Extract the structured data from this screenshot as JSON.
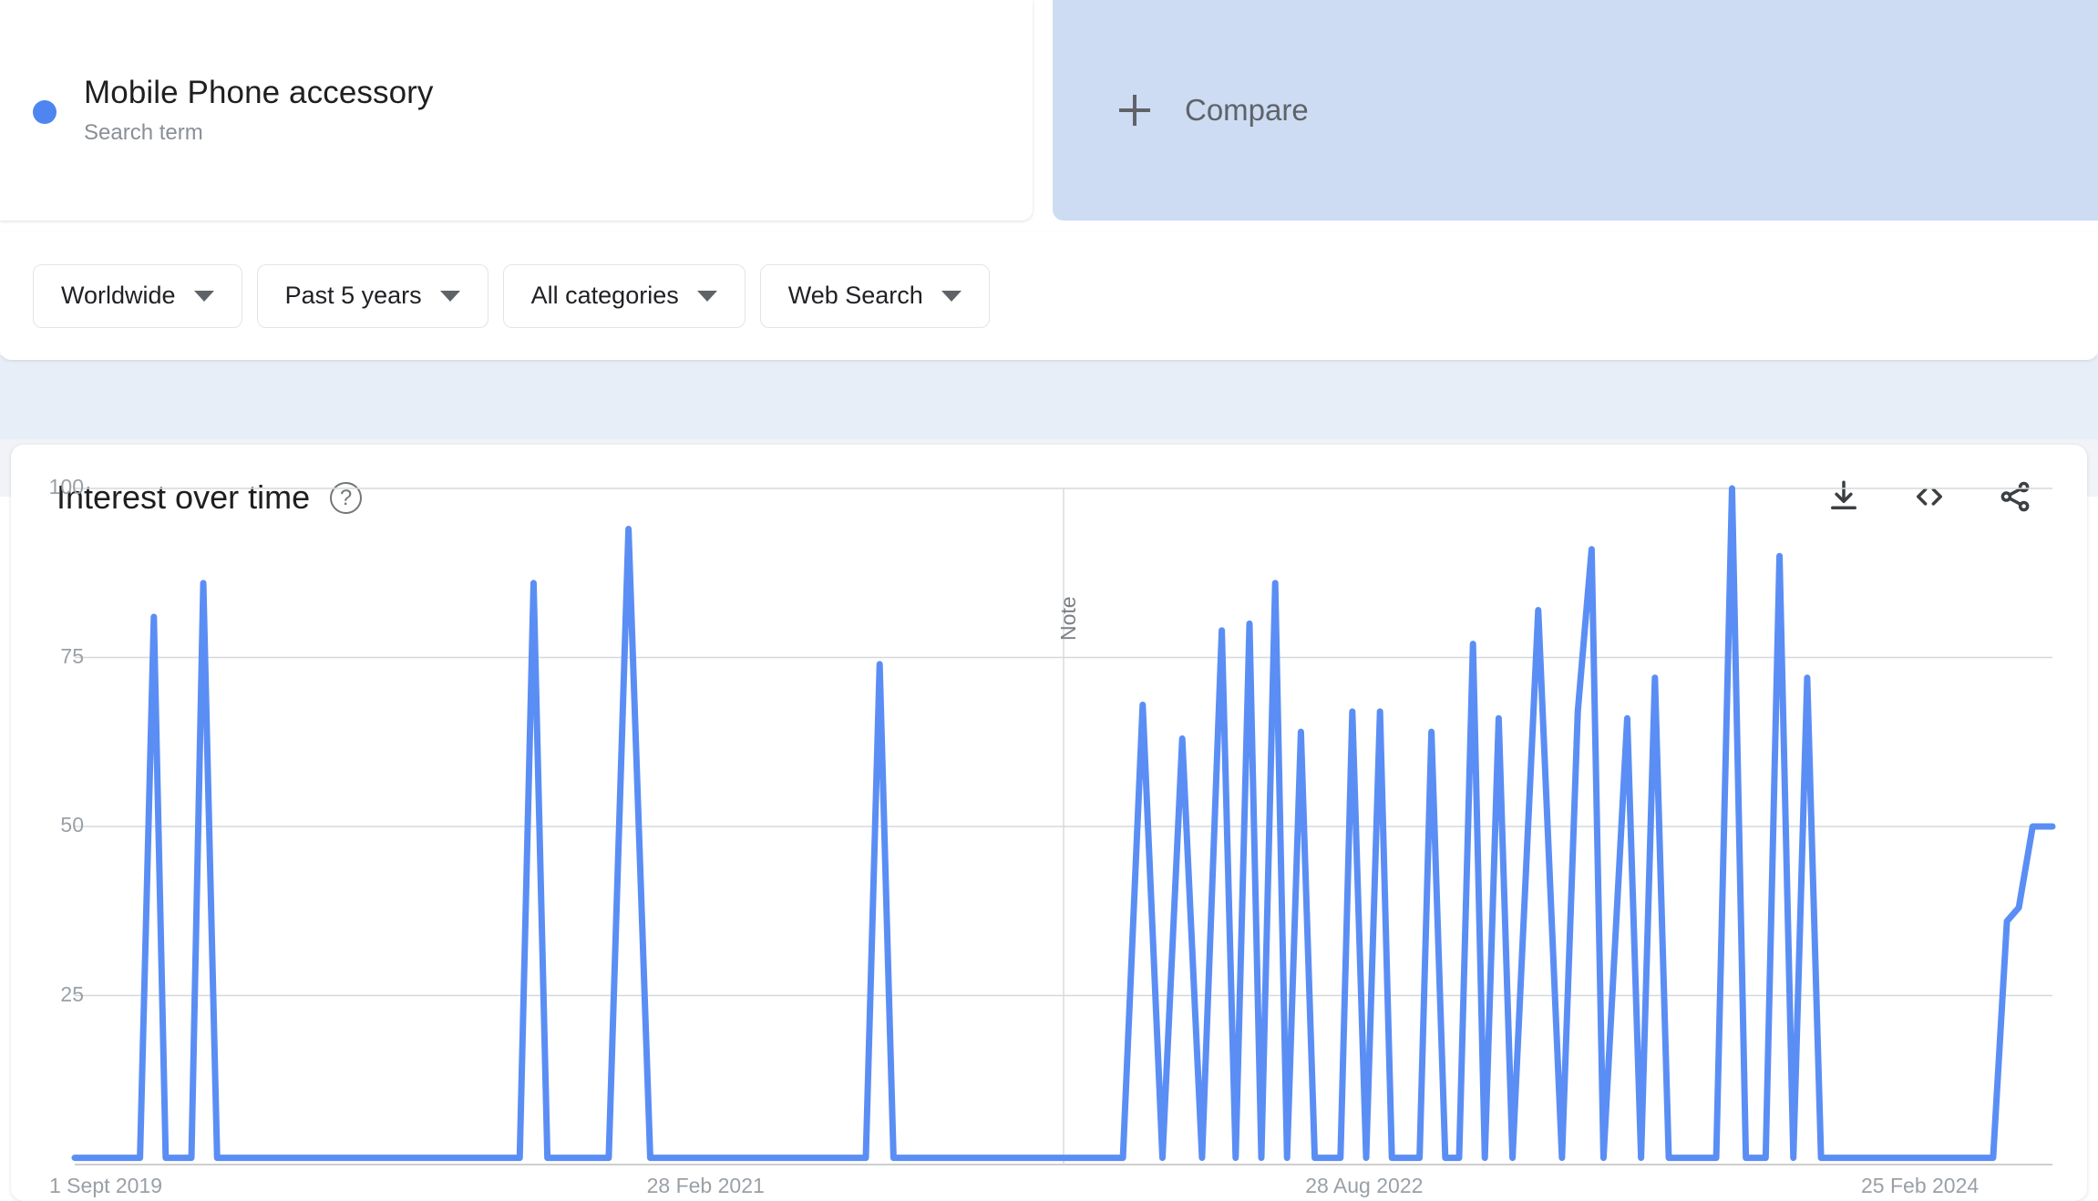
{
  "term": {
    "title": "Mobile Phone accessory",
    "subtitle": "Search term",
    "dot_color": "#4e85f0"
  },
  "compare": {
    "label": "Compare",
    "plus_icon": "plus-icon",
    "background": "#cddcf3"
  },
  "filters": [
    {
      "label": "Worldwide",
      "name": "location-filter"
    },
    {
      "label": "Past 5 years",
      "name": "time-range-filter"
    },
    {
      "label": "All categories",
      "name": "category-filter"
    },
    {
      "label": "Web Search",
      "name": "search-type-filter"
    }
  ],
  "chart_card": {
    "title": "Interest over time",
    "help_icon": "?",
    "actions": [
      {
        "name": "download-icon",
        "label": "Download"
      },
      {
        "name": "embed-code-icon",
        "label": "Embed"
      },
      {
        "name": "share-icon",
        "label": "Share"
      }
    ]
  },
  "chart_data": {
    "type": "line",
    "title": "Interest over time",
    "xlabel": "",
    "ylabel": "",
    "ylim": [
      0,
      100
    ],
    "yticks": [
      25,
      50,
      75,
      100
    ],
    "ytick_labels": [
      "25",
      "50",
      "75",
      "100"
    ],
    "xtick_labels": [
      "1 Sept 2019",
      "28 Feb 2021",
      "28 Aug 2022",
      "25 Feb 2024"
    ],
    "xtick_positions": [
      0.0,
      0.333,
      0.666,
      1.0
    ],
    "grid": true,
    "legend": [
      "Mobile Phone accessory"
    ],
    "legend_position": "top",
    "line_color": "#5b8ef4",
    "annotation": {
      "text": "Note",
      "x_fraction": 0.5,
      "orientation": "vertical"
    },
    "series": [
      {
        "name": "Mobile Phone accessory",
        "x": [
          0.0,
          0.013,
          0.026,
          0.033,
          0.04,
          0.046,
          0.052,
          0.059,
          0.065,
          0.072,
          0.078,
          0.085,
          0.091,
          0.098,
          0.104,
          0.111,
          0.13,
          0.15,
          0.17,
          0.19,
          0.21,
          0.225,
          0.232,
          0.239,
          0.246,
          0.252,
          0.259,
          0.27,
          0.28,
          0.291,
          0.297,
          0.304,
          0.31,
          0.317,
          0.324,
          0.345,
          0.365,
          0.385,
          0.4,
          0.407,
          0.414,
          0.42,
          0.427,
          0.45,
          0.47,
          0.49,
          0.5,
          0.51,
          0.52,
          0.53,
          0.54,
          0.55,
          0.56,
          0.57,
          0.58,
          0.587,
          0.594,
          0.6,
          0.607,
          0.613,
          0.62,
          0.627,
          0.633,
          0.64,
          0.646,
          0.653,
          0.66,
          0.666,
          0.673,
          0.68,
          0.686,
          0.693,
          0.7,
          0.707,
          0.713,
          0.72,
          0.727,
          0.74,
          0.752,
          0.76,
          0.767,
          0.773,
          0.785,
          0.792,
          0.799,
          0.806,
          0.82,
          0.83,
          0.838,
          0.845,
          0.855,
          0.862,
          0.869,
          0.876,
          0.883,
          0.89,
          0.895,
          0.9,
          0.905,
          0.91,
          0.917,
          0.924,
          0.93,
          0.937,
          0.95,
          0.957,
          0.963,
          0.97,
          0.977,
          0.983,
          0.99,
          1.0
        ],
        "values": [
          1,
          1,
          1,
          1,
          81,
          1,
          1,
          1,
          86,
          1,
          1,
          1,
          1,
          1,
          1,
          1,
          1,
          1,
          1,
          1,
          1,
          1,
          86,
          1,
          1,
          1,
          1,
          1,
          94,
          1,
          1,
          1,
          1,
          1,
          1,
          1,
          1,
          1,
          1,
          74,
          1,
          1,
          1,
          1,
          1,
          1,
          1,
          1,
          1,
          1,
          68,
          1,
          63,
          1,
          79,
          1,
          80,
          1,
          86,
          1,
          64,
          1,
          1,
          1,
          67,
          1,
          67,
          1,
          1,
          1,
          64,
          1,
          1,
          77,
          1,
          66,
          1,
          82,
          1,
          67,
          91,
          1,
          66,
          1,
          72,
          1,
          1,
          1,
          100,
          1,
          1,
          90,
          1,
          72,
          1,
          1,
          1,
          1,
          1,
          1,
          1,
          1,
          1,
          1,
          1,
          1,
          1,
          1,
          36,
          38,
          50,
          50
        ]
      }
    ],
    "peak_values": [
      81,
      86,
      86,
      94,
      74,
      68,
      63,
      79,
      80,
      86,
      64,
      67,
      67,
      64,
      77,
      66,
      82,
      67,
      91,
      66,
      72,
      100,
      90,
      72,
      50
    ],
    "max_value": 100,
    "baseline_value": 1
  }
}
